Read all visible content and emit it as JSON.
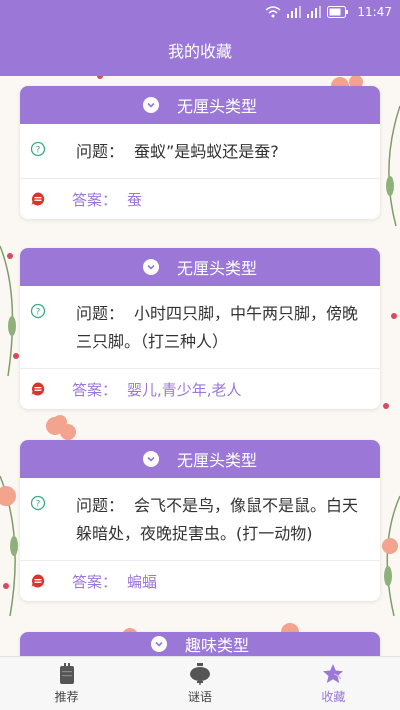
{
  "status_bar": {
    "time": "11:47"
  },
  "header": {
    "title": "我的收藏"
  },
  "question_prefix": "问题：",
  "answer_prefix": "答案：",
  "cards": [
    {
      "category": "无厘头类型",
      "question": "蚕蚁”是蚂蚁还是蚕?",
      "answer": "蚕"
    },
    {
      "category": "无厘头类型",
      "question": "小时四只脚，中午两只脚，傍晚三只脚。（打三种人）",
      "answer": "婴儿,青少年,老人"
    },
    {
      "category": "无厘头类型",
      "question": "会飞不是鸟，像鼠不是鼠。白天躲暗处，夜晚捉害虫。(打一动物)",
      "answer": "蝙蝠"
    },
    {
      "category": "趣味类型"
    }
  ],
  "bottom_nav": {
    "items": [
      {
        "label": "推荐",
        "icon": "book-icon"
      },
      {
        "label": "谜语",
        "icon": "lantern-icon"
      },
      {
        "label": "收藏",
        "icon": "star-icon",
        "active": true
      }
    ]
  },
  "colors": {
    "accent": "#9b77d8",
    "question_icon": "#3aaa8a",
    "answer_icon": "#d9352b"
  }
}
